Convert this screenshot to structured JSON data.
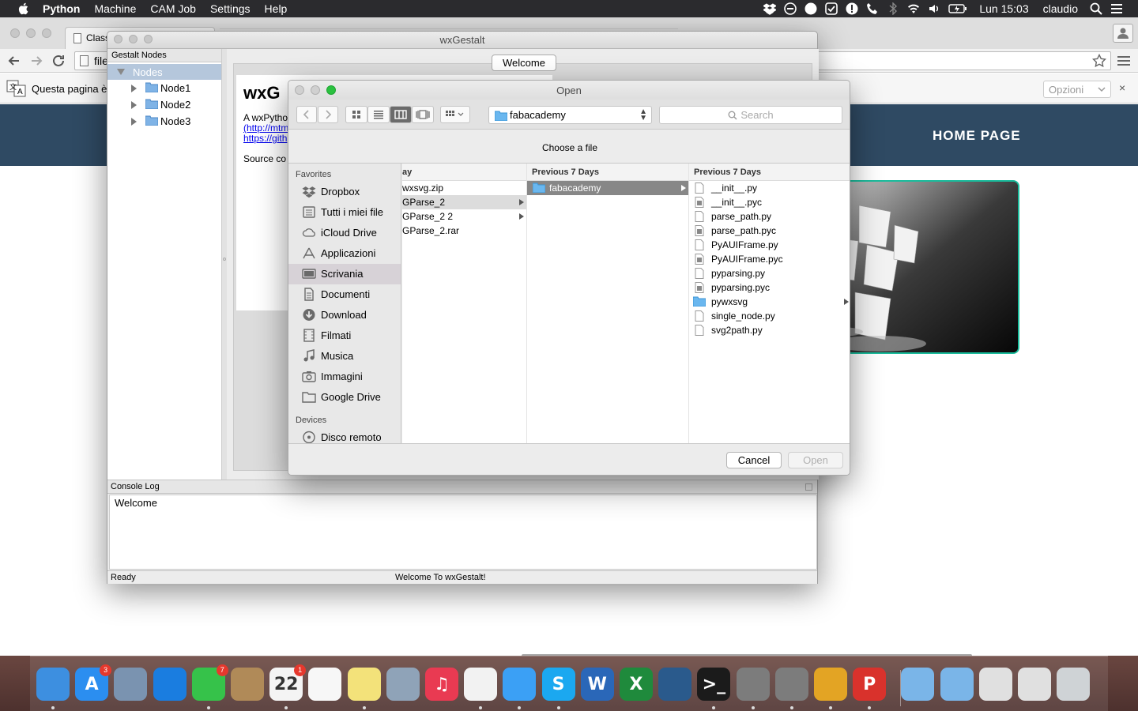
{
  "menubar": {
    "app_name": "Python",
    "items": [
      "Machine",
      "CAM Job",
      "Settings",
      "Help"
    ],
    "clock": "Lun 15:03",
    "user": "claudio",
    "status_icons": [
      "dropbox-icon",
      "sync-icon",
      "circle-icon",
      "check-icon",
      "alert-icon",
      "phone-icon",
      "bluetooth-icon",
      "wifi-icon",
      "volume-icon",
      "battery-icon"
    ]
  },
  "browser": {
    "tab_title": "Class",
    "url": "file",
    "translate_message": "Questa pagina è",
    "options_label": "Opzioni",
    "close_label": "×",
    "home_link": "HOME PAGE"
  },
  "wx": {
    "title": "wxGestalt",
    "tree_header": "Gestalt Nodes",
    "tree_root": "Nodes",
    "nodes": [
      "Node1",
      "Node2",
      "Node3"
    ],
    "tab_label": "Welcome",
    "html_title": "wxG",
    "html_line1": "A wxPytho",
    "html_link1": "(http://mtm",
    "html_link2": "https://gith",
    "html_source": "Source co",
    "console_header": "Console Log",
    "console_text": "Welcome",
    "status_left": "Ready",
    "status_mid": "Welcome To wxGestalt!"
  },
  "dialog": {
    "title": "Open",
    "path": "fabacademy",
    "search_placeholder": "Search",
    "choose_label": "Choose a file",
    "sidebar_favorites": "Favorites",
    "favorites": [
      {
        "label": "Dropbox",
        "icon": "dropbox-icon"
      },
      {
        "label": "Tutti i miei file",
        "icon": "all-files-icon"
      },
      {
        "label": "iCloud Drive",
        "icon": "cloud-icon"
      },
      {
        "label": "Applicazioni",
        "icon": "applications-icon"
      },
      {
        "label": "Scrivania",
        "icon": "desktop-icon"
      },
      {
        "label": "Documenti",
        "icon": "documents-icon"
      },
      {
        "label": "Download",
        "icon": "download-icon"
      },
      {
        "label": "Filmati",
        "icon": "movies-icon"
      },
      {
        "label": "Musica",
        "icon": "music-icon"
      },
      {
        "label": "Immagini",
        "icon": "pictures-icon"
      },
      {
        "label": "Google Drive",
        "icon": "folder-icon"
      }
    ],
    "sidebar_devices": "Devices",
    "devices": [
      {
        "label": "Disco remoto",
        "icon": "disc-icon"
      }
    ],
    "col1": {
      "header": "ay",
      "rows": [
        "wxsvg.zip",
        "GParse_2",
        "GParse_2 2",
        "GParse_2.rar"
      ]
    },
    "col2": {
      "header": "Previous 7 Days",
      "rows": [
        "fabacademy"
      ]
    },
    "col3": {
      "header": "Previous 7 Days",
      "rows": [
        "__init__.py",
        "__init__.pyc",
        "parse_path.py",
        "parse_path.pyc",
        "PyAUIFrame.py",
        "PyAUIFrame.pyc",
        "pyparsing.py",
        "pyparsing.pyc",
        "pywxsvg",
        "single_node.py",
        "svg2path.py"
      ]
    },
    "cancel_label": "Cancel",
    "open_label": "Open"
  },
  "dock": {
    "apps": [
      {
        "name": "finder",
        "color": "#3d8fe0",
        "glyph": ""
      },
      {
        "name": "app-store",
        "color": "#2b8ef0",
        "glyph": "A",
        "badge": "3"
      },
      {
        "name": "preview",
        "color": "#7a93b0",
        "glyph": ""
      },
      {
        "name": "safari",
        "color": "#1a7de0",
        "glyph": ""
      },
      {
        "name": "facetime",
        "color": "#36c24a",
        "glyph": "",
        "badge": "7"
      },
      {
        "name": "contacts",
        "color": "#b08a58",
        "glyph": ""
      },
      {
        "name": "calendar",
        "color": "#f4f4f4",
        "glyph": "22",
        "badge": "1"
      },
      {
        "name": "reminders",
        "color": "#f7f7f7",
        "glyph": ""
      },
      {
        "name": "notes",
        "color": "#f3e27a",
        "glyph": ""
      },
      {
        "name": "system-prefs",
        "color": "#8fa3b8",
        "glyph": ""
      },
      {
        "name": "itunes",
        "color": "#e93a52",
        "glyph": "♫"
      },
      {
        "name": "photos",
        "color": "#f2f2f2",
        "glyph": ""
      },
      {
        "name": "messages",
        "color": "#3ba0f5",
        "glyph": ""
      },
      {
        "name": "skype",
        "color": "#1ba8f0",
        "glyph": "S"
      },
      {
        "name": "word",
        "color": "#2a67b8",
        "glyph": "W"
      },
      {
        "name": "excel",
        "color": "#1f8a3c",
        "glyph": "X"
      },
      {
        "name": "unknown-app",
        "color": "#2a5a8c",
        "glyph": ""
      },
      {
        "name": "terminal",
        "color": "#1b1b1b",
        "glyph": ">_"
      },
      {
        "name": "inkscape-1",
        "color": "#7c7c7c",
        "glyph": ""
      },
      {
        "name": "inkscape-2",
        "color": "#7c7c7c",
        "glyph": ""
      },
      {
        "name": "chrome",
        "color": "#e3a424",
        "glyph": ""
      },
      {
        "name": "pdf-app",
        "color": "#d9322c",
        "glyph": "P"
      },
      {
        "name": "downloads-stack",
        "color": "#7ab5e8",
        "glyph": ""
      },
      {
        "name": "documents-stack",
        "color": "#7ab5e8",
        "glyph": ""
      },
      {
        "name": "docs-stack-1",
        "color": "#e0e0e0",
        "glyph": ""
      },
      {
        "name": "docs-stack-2",
        "color": "#e0e0e0",
        "glyph": ""
      },
      {
        "name": "trash",
        "color": "#cfd3d6",
        "glyph": ""
      }
    ]
  },
  "colors": {
    "site_header": "#2f4a63",
    "accent_frame": "#1abc9c",
    "tree_selection": "#b5c7dc",
    "column_selection": "#878787"
  }
}
